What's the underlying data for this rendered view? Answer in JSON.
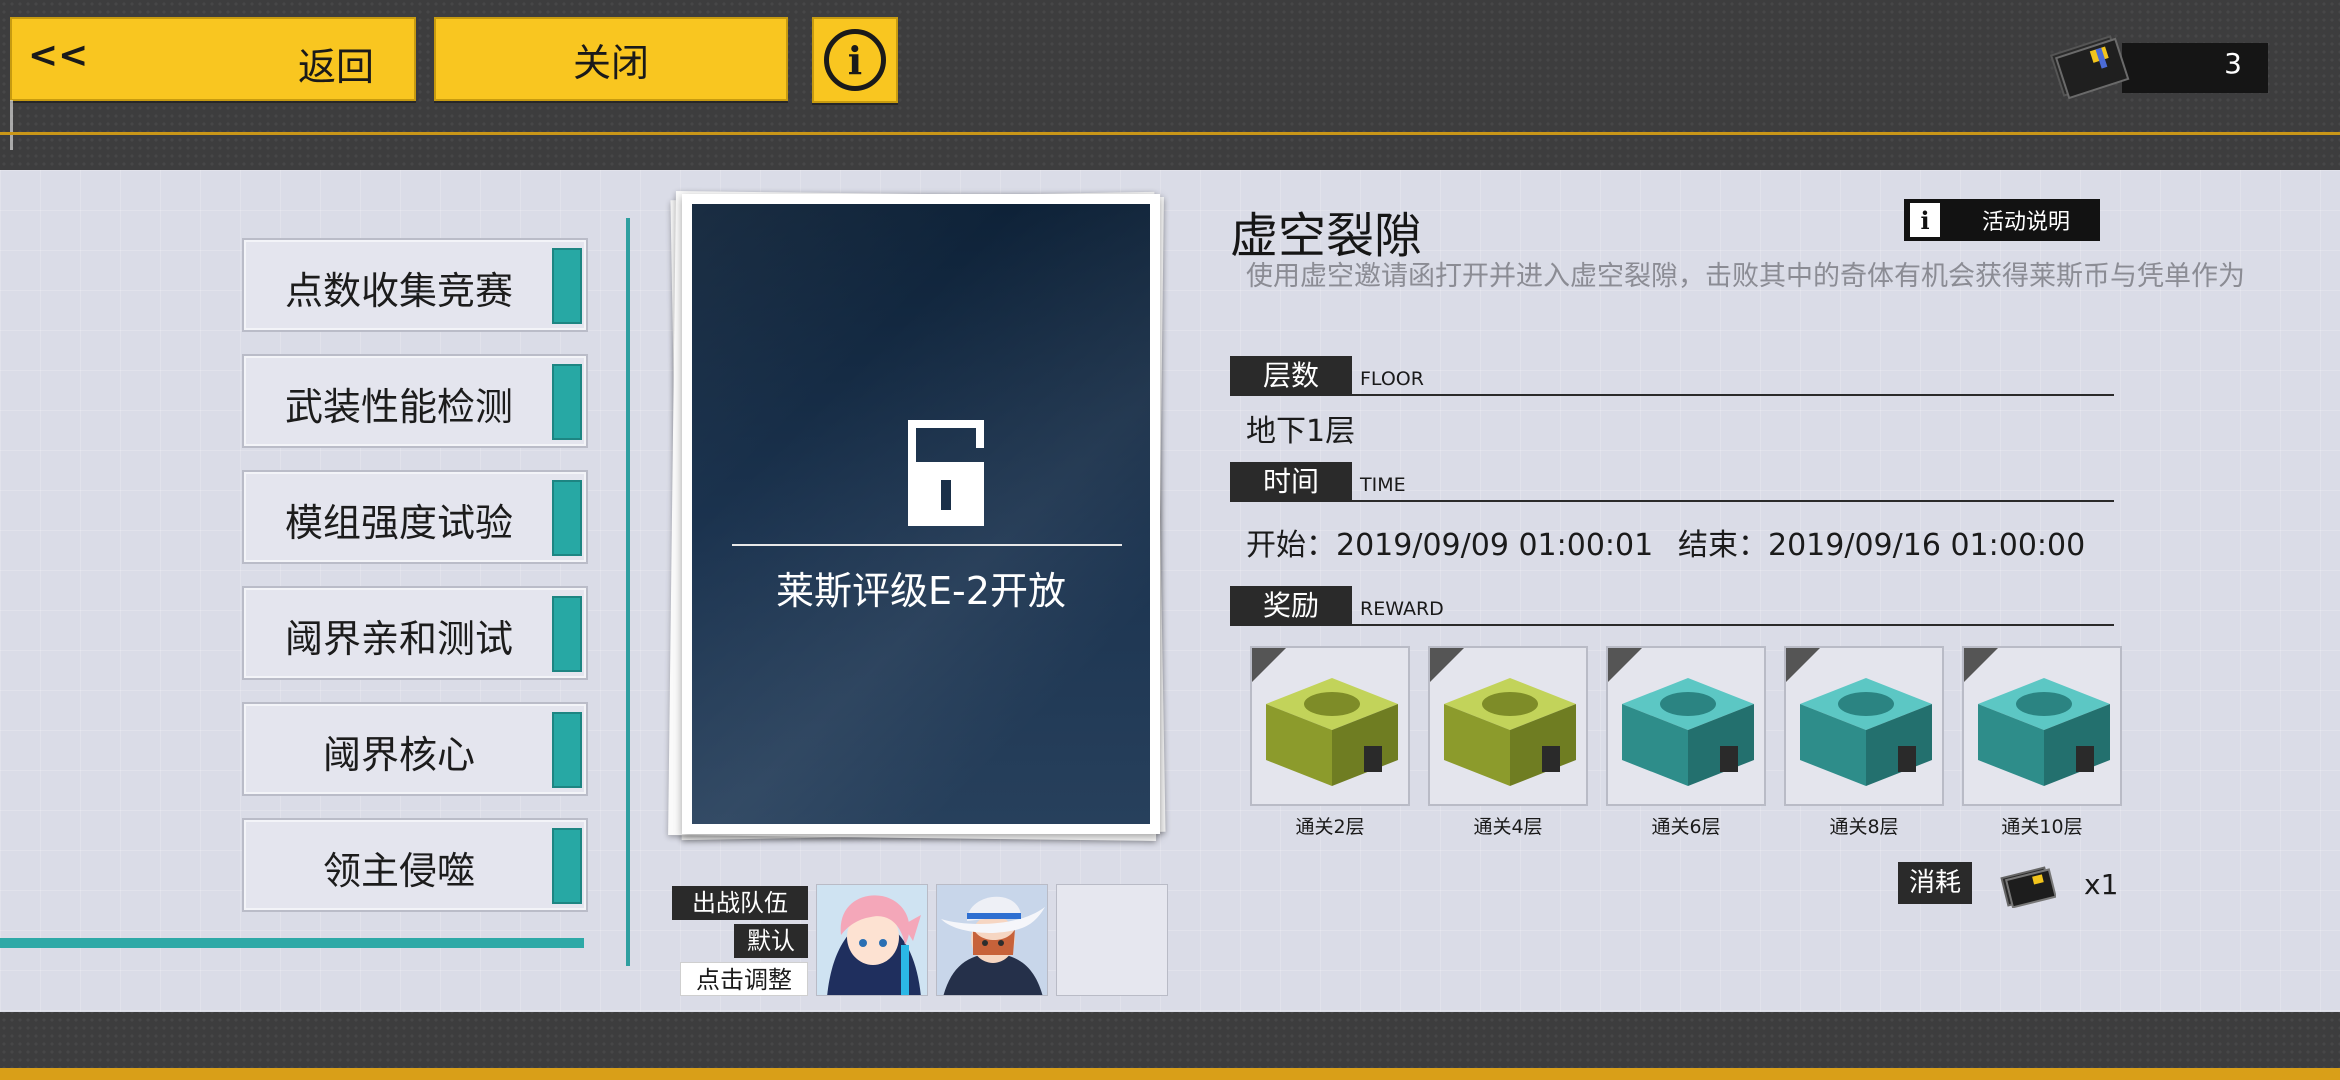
{
  "topbar": {
    "back_arrows": "<<",
    "back_label": "返回",
    "close_label": "关闭",
    "currency_value": "3"
  },
  "menu": {
    "items": [
      {
        "label": "点数收集竞赛"
      },
      {
        "label": "武装性能检测"
      },
      {
        "label": "模组强度试验"
      },
      {
        "label": "阈界亲和测试"
      },
      {
        "label": "阈界核心"
      },
      {
        "label": "领主侵噬"
      }
    ]
  },
  "card": {
    "caption": "莱斯评级E-2开放"
  },
  "team": {
    "title": "出战队伍",
    "preset": "默认",
    "adjust": "点击调整"
  },
  "detail": {
    "title": "虚空裂隙",
    "description": "使用虚空邀请函打开并进入虚空裂隙，击败其中的奇体有机会获得莱斯币与凭单作为",
    "activity_button": "活动说明",
    "floor_label_cn": "层数",
    "floor_label_en": "FLOOR",
    "floor_value": "地下1层",
    "time_label_cn": "时间",
    "time_label_en": "TIME",
    "start_text": "开始：2019/09/09 01:00:01",
    "end_text": "结束：2019/09/16 01:00:00",
    "reward_label_cn": "奖励",
    "reward_label_en": "REWARD",
    "rewards": [
      {
        "label": "通关2层",
        "color": "#a4b63a"
      },
      {
        "label": "通关4层",
        "color": "#a4b63a"
      },
      {
        "label": "通关6层",
        "color": "#3fa8a6"
      },
      {
        "label": "通关8层",
        "color": "#3fa8a6"
      },
      {
        "label": "通关10层",
        "color": "#3fa8a6"
      }
    ],
    "consume_label": "消耗",
    "consume_value": "x1"
  },
  "colors": {
    "accent_yellow": "#f9c620",
    "accent_teal": "#27a8a4",
    "panel_bg": "#dadce7"
  }
}
